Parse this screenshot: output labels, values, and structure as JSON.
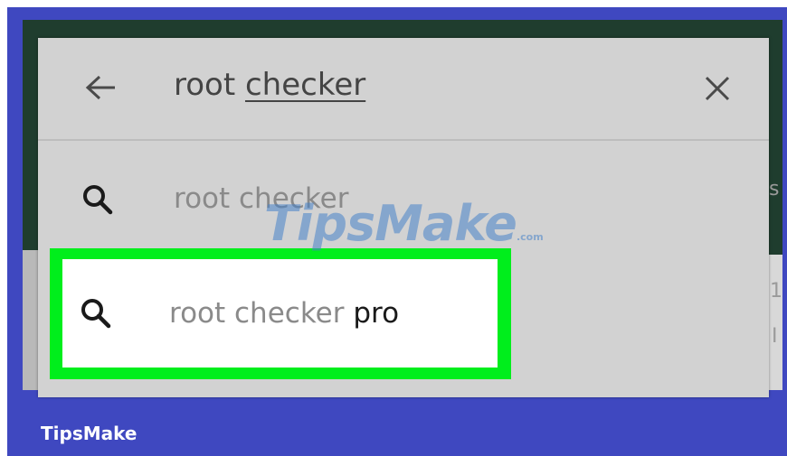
{
  "search": {
    "query_plain": "root ",
    "query_underlined": "checker"
  },
  "suggestions": [
    {
      "plain": "root checker",
      "bold": ""
    },
    {
      "plain": "root checker ",
      "bold": "pro"
    }
  ],
  "background_peek": [
    "s",
    "1",
    "I"
  ],
  "watermark": {
    "text": "TipsMake",
    "suffix": ".com"
  },
  "footer": {
    "brand": "TipsMake"
  },
  "colors": {
    "frame": "#3f48c0",
    "highlight": "#00ee1c",
    "panel": "#d2d2d2",
    "app_bar": "#1f3d2e"
  },
  "icons": {
    "back": "arrow-left-icon",
    "clear": "close-icon",
    "suggestion": "search-icon"
  }
}
